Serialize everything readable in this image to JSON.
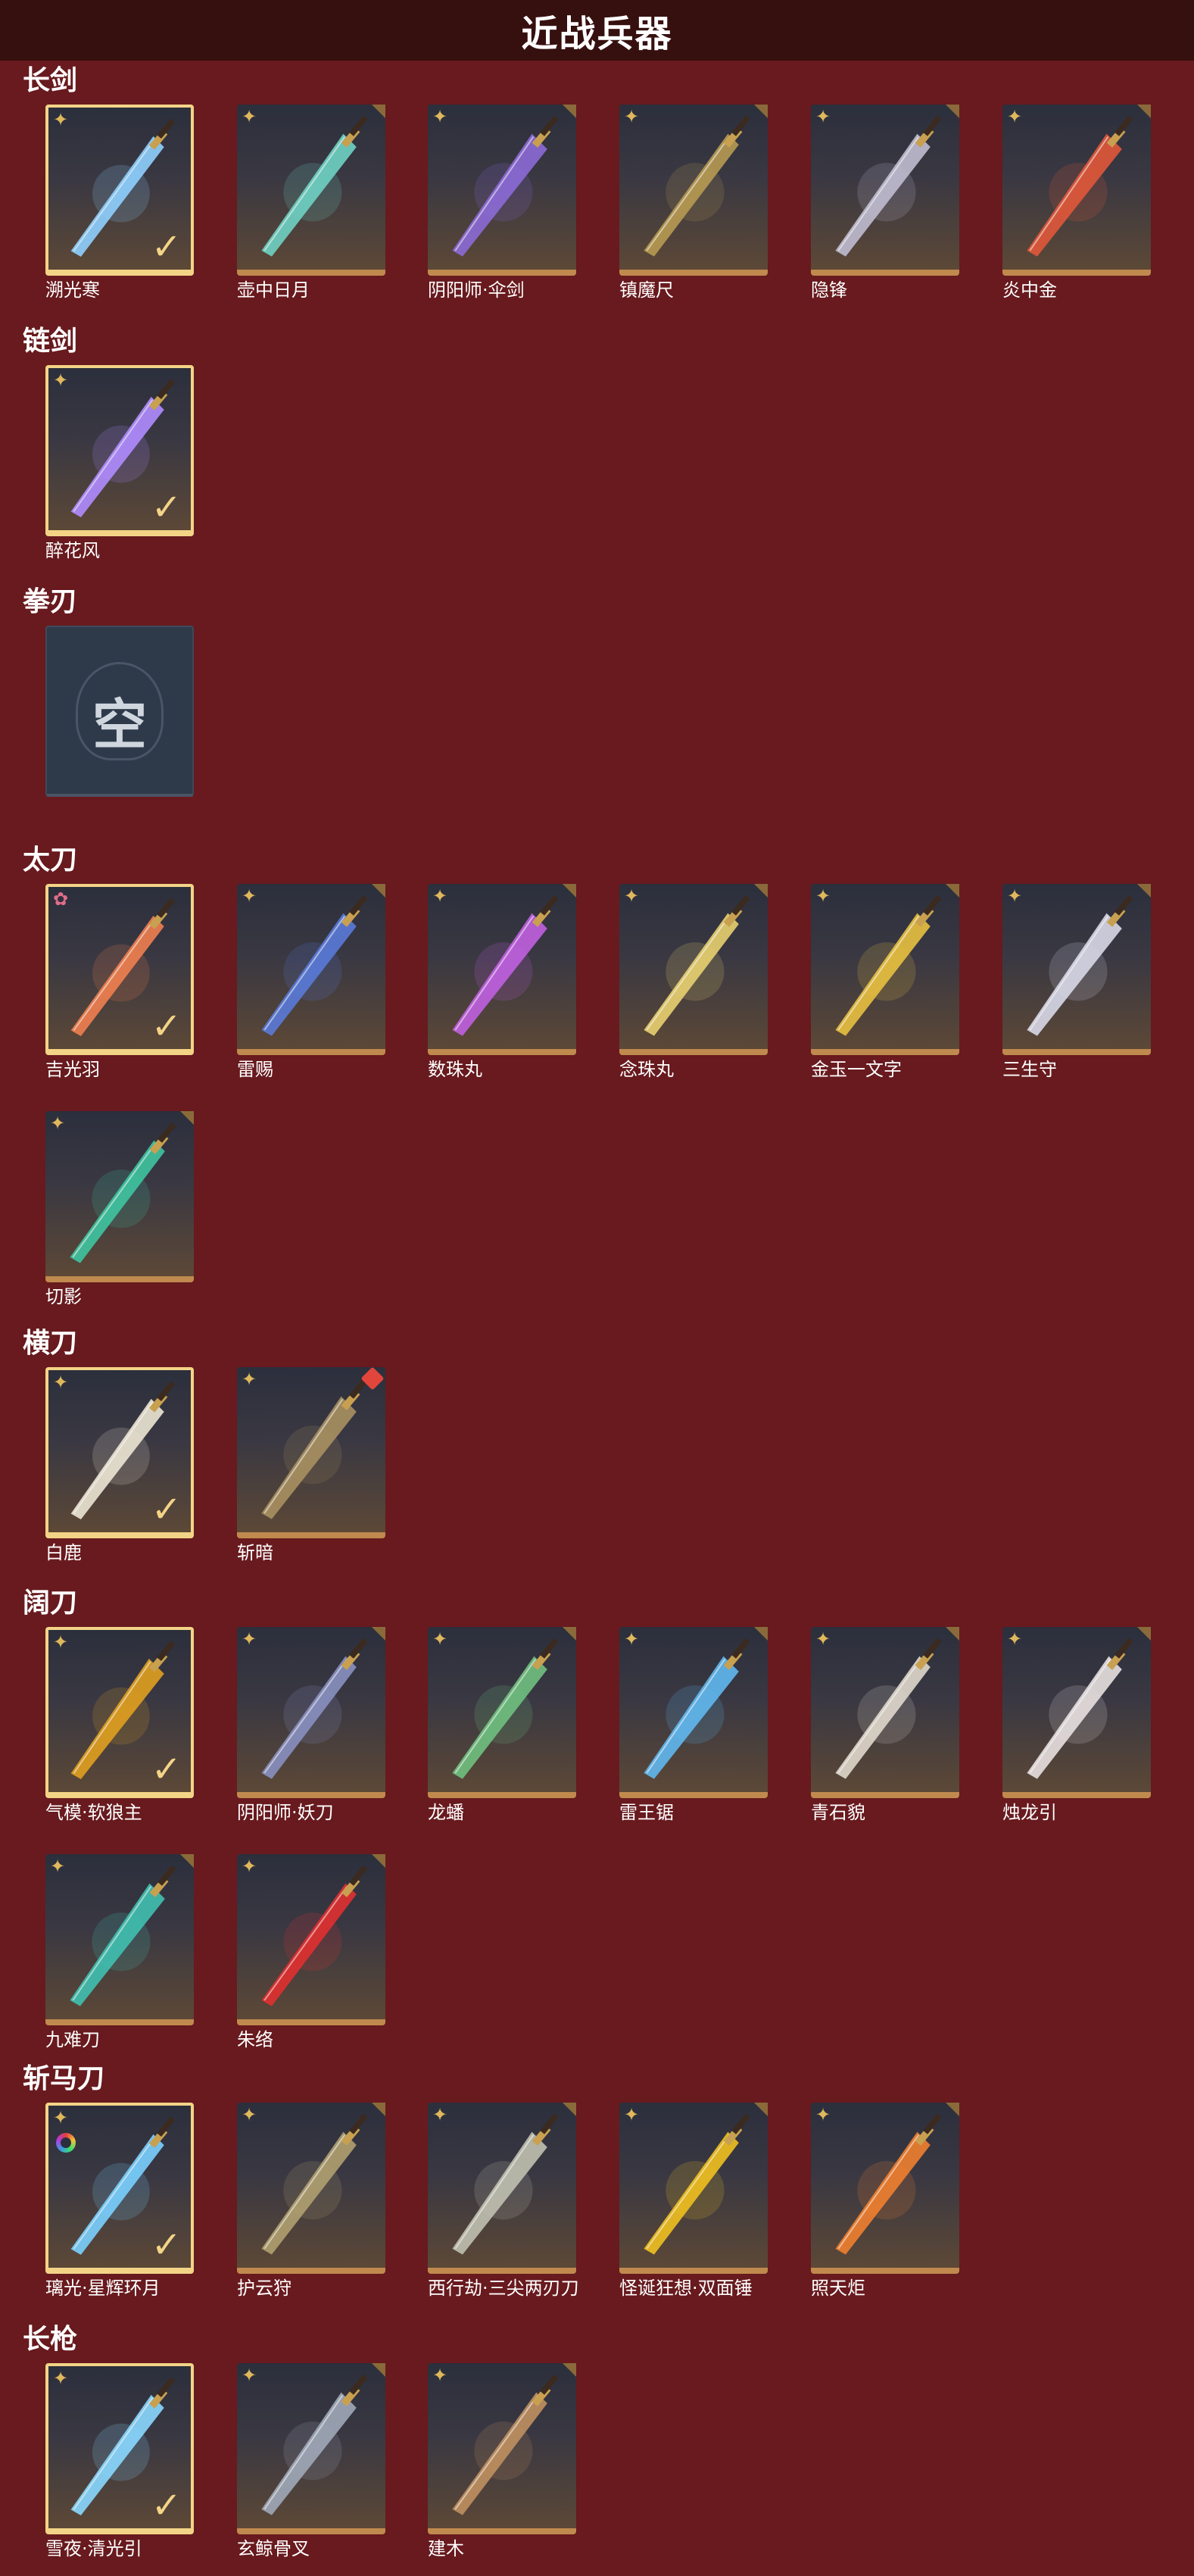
{
  "page_title": "近战兵器",
  "sections": [
    {
      "title": "长剑",
      "items": [
        {
          "name": "溯光寒",
          "selected": true,
          "icon": "blue-crystal-sword-icon",
          "color": "#8fd0ff"
        },
        {
          "name": "壶中日月",
          "icon": "jade-sword-icon",
          "color": "#6fd1c3"
        },
        {
          "name": "阴阳师·伞剑",
          "icon": "purple-umbrella-sword-icon",
          "color": "#8c6ad6"
        },
        {
          "name": "镇魔尺",
          "icon": "bronze-ruler-sword-icon",
          "color": "#b79a52"
        },
        {
          "name": "隐锋",
          "icon": "slim-red-sword-icon",
          "color": "#c0bcd0"
        },
        {
          "name": "炎中金",
          "icon": "flame-sword-icon",
          "color": "#e0583a"
        }
      ]
    },
    {
      "title": "链剑",
      "items": [
        {
          "name": "醉花风",
          "selected": true,
          "icon": "purple-chain-sword-icon",
          "color": "#b08cff"
        }
      ]
    },
    {
      "title": "拳刃",
      "items": [
        {
          "name": "",
          "empty": true,
          "empty_text": "空",
          "icon": "empty-slot-icon"
        }
      ]
    },
    {
      "title": "太刀",
      "items": [
        {
          "name": "吉光羽",
          "selected": true,
          "pink": true,
          "icon": "golden-flame-katana-icon",
          "color": "#f08050"
        },
        {
          "name": "雷赐",
          "icon": "blue-gold-katana-icon",
          "color": "#5a7ad8"
        },
        {
          "name": "数珠丸",
          "icon": "purple-katana-icon",
          "color": "#c060e0"
        },
        {
          "name": "念珠丸",
          "icon": "white-gold-katana-icon",
          "color": "#e8d070"
        },
        {
          "name": "金玉一文字",
          "icon": "gold-katana-icon",
          "color": "#e8c040"
        },
        {
          "name": "三生守",
          "icon": "silver-katana-icon",
          "color": "#d8d8e8"
        },
        {
          "name": "切影",
          "icon": "green-shadow-katana-icon",
          "color": "#3fc4a0"
        }
      ]
    },
    {
      "title": "横刀",
      "items": [
        {
          "name": "白鹿",
          "selected": true,
          "icon": "white-deer-blade-icon",
          "color": "#ece6d4"
        },
        {
          "name": "斩暗",
          "gem": true,
          "icon": "dark-bronze-blade-icon",
          "color": "#a89060"
        }
      ]
    },
    {
      "title": "阔刀",
      "items": [
        {
          "name": "气模·软狼主",
          "selected": true,
          "icon": "red-gold-broadsword-icon",
          "color": "#e0a020"
        },
        {
          "name": "阴阳师·妖刀",
          "icon": "dark-curved-blade-icon",
          "color": "#8890c0"
        },
        {
          "name": "龙蟠",
          "icon": "green-dragon-broadsword-icon",
          "color": "#70c080"
        },
        {
          "name": "雷王锯",
          "icon": "blue-lightning-broadsword-icon",
          "color": "#60b8f0"
        },
        {
          "name": "青石貌",
          "icon": "white-stone-broadsword-icon",
          "color": "#e0d8cc"
        },
        {
          "name": "烛龙引",
          "icon": "white-dragon-broadsword-icon",
          "color": "#e8e0e0"
        },
        {
          "name": "九难刀",
          "icon": "teal-gold-broadsword-icon",
          "color": "#40c0b0"
        },
        {
          "name": "朱络",
          "icon": "crimson-ribbon-broadsword-icon",
          "color": "#e03030"
        }
      ]
    },
    {
      "title": "斩马刀",
      "items": [
        {
          "name": "璃光·星辉环月",
          "selected": true,
          "ring": true,
          "icon": "crystal-moon-glaive-icon",
          "color": "#7ad0ff"
        },
        {
          "name": "护云狩",
          "icon": "bronze-glaive-icon",
          "color": "#b0a070"
        },
        {
          "name": "西行劫·三尖两刃刀",
          "icon": "trident-glaive-icon",
          "color": "#c0c0b0"
        },
        {
          "name": "怪诞狂想·双面锤",
          "icon": "toy-hammer-icon",
          "color": "#f0c020"
        },
        {
          "name": "照天炬",
          "icon": "flame-glaive-icon",
          "color": "#f08030"
        }
      ]
    },
    {
      "title": "长枪",
      "items": [
        {
          "name": "雪夜·清光引",
          "selected": true,
          "icon": "ice-spear-icon",
          "color": "#8ad8ff"
        },
        {
          "name": "玄鲸骨叉",
          "icon": "whale-bone-spear-icon",
          "color": "#a0a8b8"
        },
        {
          "name": "建木",
          "icon": "wood-spear-icon",
          "color": "#c09060"
        }
      ]
    }
  ]
}
